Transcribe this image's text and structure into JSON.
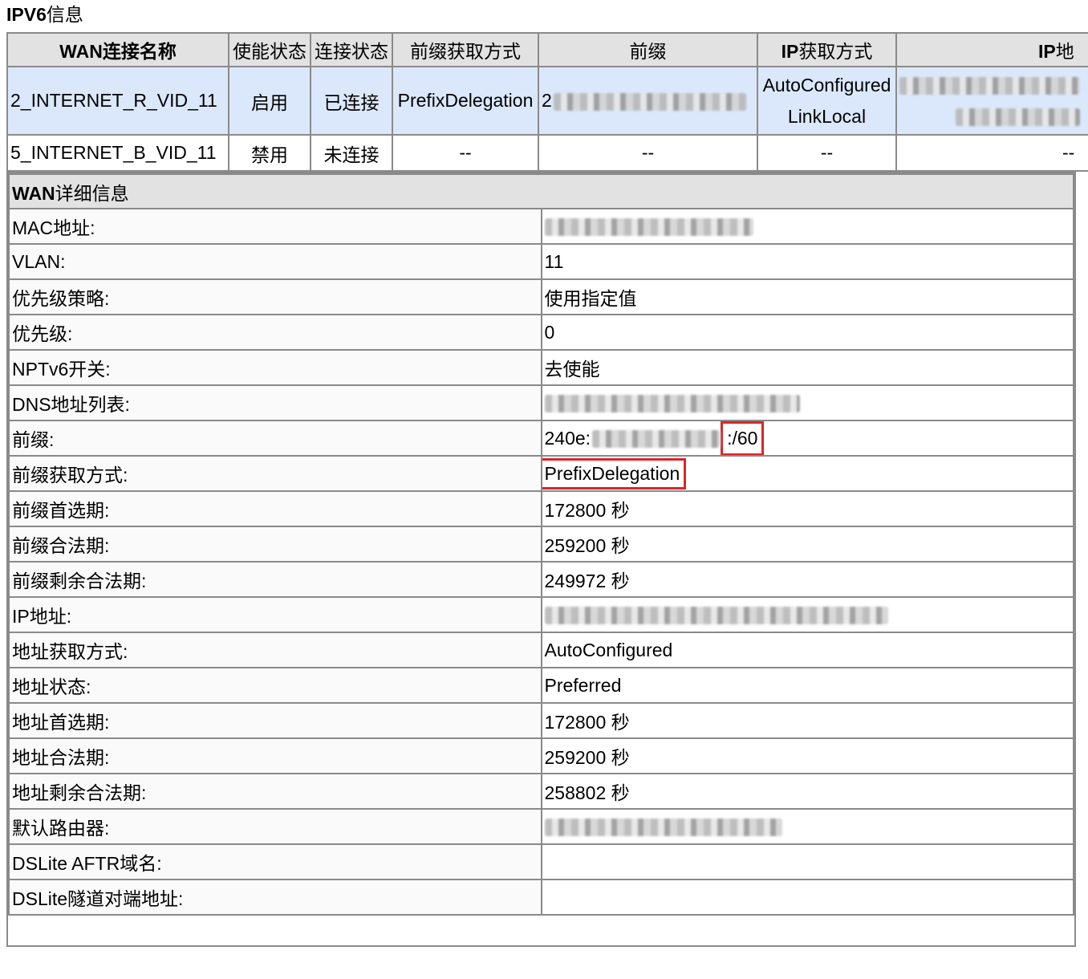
{
  "page": {
    "title_bold": "IPV6",
    "title_rest": "信息"
  },
  "wan_table": {
    "headers": {
      "name_bold": "WAN",
      "name_rest": "连接名称",
      "enable": "使能状态",
      "conn": "连接状态",
      "prefix_method": "前缀获取方式",
      "prefix": "前缀",
      "ip_method_bold": "IP",
      "ip_method_rest": "获取方式",
      "ip_addr_bold": "IP",
      "ip_addr_rest": "地"
    },
    "rows": [
      {
        "name": "2_INTERNET_R_VID_11",
        "enable": "启用",
        "conn": "已连接",
        "prefix_method": "PrefixDelegation",
        "prefix": "2",
        "ip_method_1": "AutoConfigured",
        "ip_method_2": "LinkLocal",
        "ip_addr": ""
      },
      {
        "name": "5_INTERNET_B_VID_11",
        "enable": "禁用",
        "conn": "未连接",
        "prefix_method": "--",
        "prefix": "--",
        "ip_method": "--",
        "ip_addr": "--"
      }
    ]
  },
  "detail": {
    "title_bold": "WAN",
    "title_rest": "详细信息",
    "rows": [
      {
        "label": "MAC地址:",
        "value": ""
      },
      {
        "label": "VLAN:",
        "value": "11"
      },
      {
        "label": "优先级策略:",
        "value": "使用指定值"
      },
      {
        "label": "优先级:",
        "value": "0"
      },
      {
        "label": "NPTv6开关:",
        "value": "去使能"
      },
      {
        "label": "DNS地址列表:",
        "value": ""
      },
      {
        "label": "前缀:",
        "value_prefix": "240e:",
        "value_suffix": ":/60"
      },
      {
        "label": "前缀获取方式:",
        "value": "PrefixDelegation"
      },
      {
        "label": "前缀首选期:",
        "value": "172800 秒"
      },
      {
        "label": "前缀合法期:",
        "value": "259200 秒"
      },
      {
        "label": "前缀剩余合法期:",
        "value": "249972 秒"
      },
      {
        "label": "IP地址:",
        "value": ""
      },
      {
        "label": "地址获取方式:",
        "value": "AutoConfigured"
      },
      {
        "label": "地址状态:",
        "value": "Preferred"
      },
      {
        "label": "地址首选期:",
        "value": "172800 秒"
      },
      {
        "label": "地址合法期:",
        "value": "259200 秒"
      },
      {
        "label": "地址剩余合法期:",
        "value": "258802 秒"
      },
      {
        "label": "默认路由器:",
        "value": ""
      },
      {
        "label": "DSLite AFTR域名:",
        "value": ""
      },
      {
        "label": "DSLite隧道对端地址:",
        "value": ""
      }
    ]
  },
  "colors": {
    "header_bg": "#e2e2e2",
    "active_row_bg": "#dbe8fb",
    "border": "#8a8a8a",
    "highlight_box": "#d92626"
  }
}
